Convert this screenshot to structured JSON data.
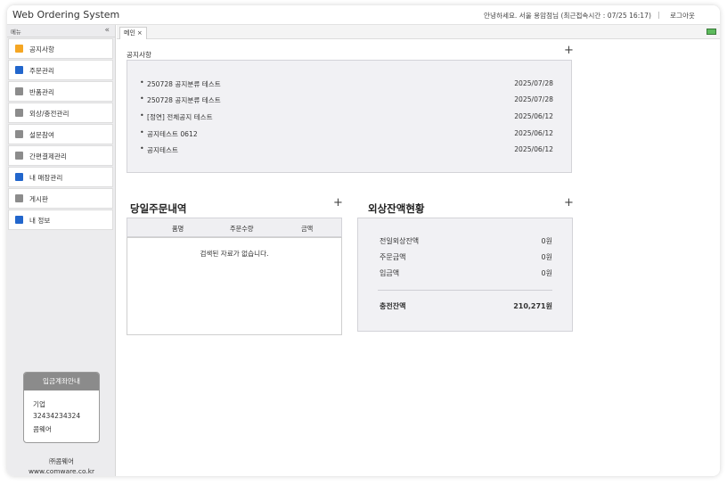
{
  "header": {
    "title": "Web Ordering System",
    "greeting": "안녕하세요. 서울 용암점님 (최근접속시간 : 07/25 16:17)",
    "separator": "|",
    "logout": "로그아웃"
  },
  "sidebar": {
    "menu_label": "메뉴",
    "collapse_glyph": "«",
    "items": [
      {
        "label": "공지사항",
        "color": "#f5a623"
      },
      {
        "label": "주문관리",
        "color": "#2266cc"
      },
      {
        "label": "반품관리",
        "color": "#8c8c8c"
      },
      {
        "label": "외상/충전관리",
        "color": "#8c8c8c"
      },
      {
        "label": "설문참여",
        "color": "#8c8c8c"
      },
      {
        "label": "간편결제관리",
        "color": "#8c8c8c"
      },
      {
        "label": "내 매장관리",
        "color": "#2266cc"
      },
      {
        "label": "게시판",
        "color": "#8c8c8c"
      },
      {
        "label": "내 정보",
        "color": "#2266cc"
      }
    ],
    "bank": {
      "title": "입금계좌안내",
      "bank_name": "기업",
      "account": "32434234324",
      "holder": "콤웨어"
    },
    "company": {
      "name": "㈜콤웨어",
      "url": "www.comware.co.kr"
    }
  },
  "tabs": [
    {
      "label": "메인",
      "close": "×"
    }
  ],
  "icons": {
    "plus": "+",
    "bullet": "•"
  },
  "notices": {
    "title": "공지사항",
    "items": [
      {
        "title": "250728 공지분류 테스트",
        "date": "2025/07/28"
      },
      {
        "title": "250728 공지분류 테스트",
        "date": "2025/07/28"
      },
      {
        "title": "[정연] 전체공지 테스트",
        "date": "2025/06/12"
      },
      {
        "title": "공지테스트 0612",
        "date": "2025/06/12"
      },
      {
        "title": "공지테스트",
        "date": "2025/06/12"
      }
    ]
  },
  "orders": {
    "title": "당일주문내역",
    "columns": [
      "품명",
      "주문수량",
      "금액"
    ],
    "empty_message": "검색된 자료가 없습니다."
  },
  "balance": {
    "title": "외상잔액현황",
    "rows": [
      {
        "label": "전일외상잔액",
        "value": "0원"
      },
      {
        "label": "주문금액",
        "value": "0원"
      },
      {
        "label": "입금액",
        "value": "0원"
      }
    ],
    "total_label": "충전잔액",
    "total_value": "210,271원"
  }
}
